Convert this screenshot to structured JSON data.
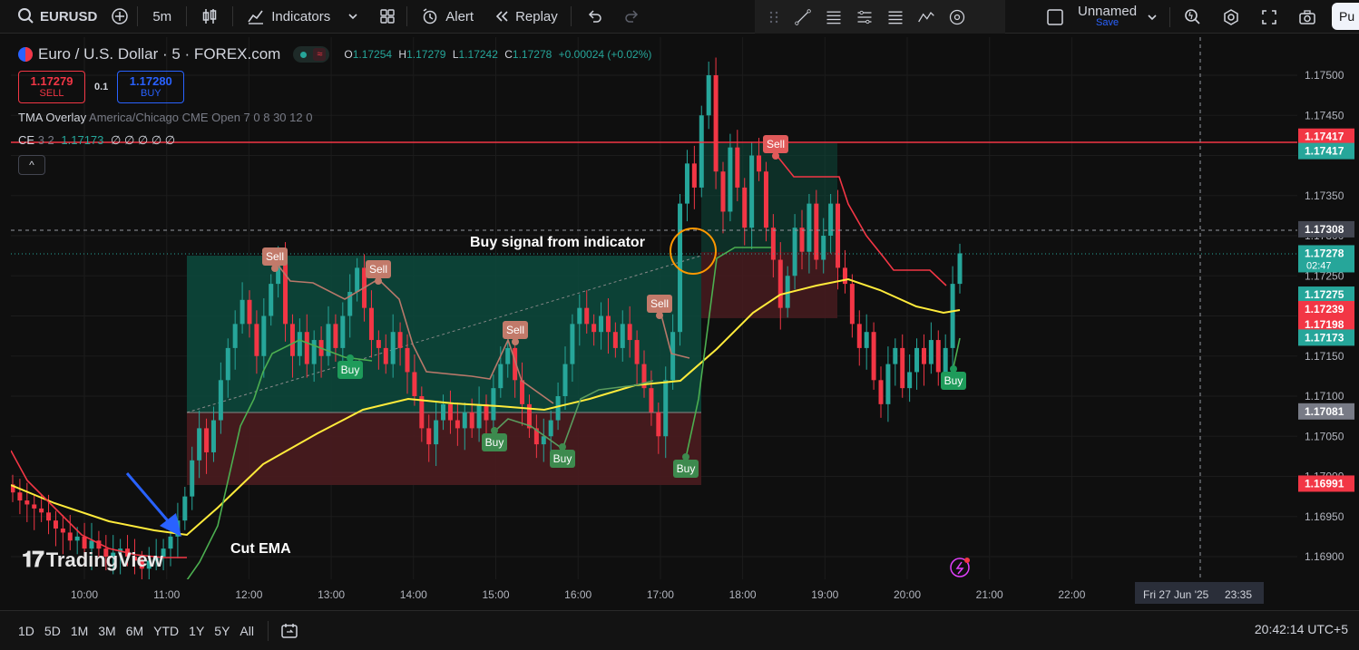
{
  "toolbar": {
    "symbol": "EURUSD",
    "interval": "5m",
    "indicators_label": "Indicators",
    "alert_label": "Alert",
    "replay_label": "Replay",
    "layout_name": "Unnamed",
    "layout_save": "Save",
    "publish_label": "Pu"
  },
  "legend": {
    "title": "Euro / U.S. Dollar · 5 · FOREX.com",
    "open_label": "O",
    "open": "1.17254",
    "high_label": "H",
    "high": "1.17279",
    "low_label": "L",
    "low": "1.17242",
    "close_label": "C",
    "close": "1.17278",
    "change": "+0.00024 (+0.02%)",
    "sell_price": "1.17279",
    "sell_label": "SELL",
    "buy_price": "1.17280",
    "buy_label": "BUY",
    "quantity": "0.1",
    "ind1_name": "TMA Overlay",
    "ind1_params": "America/Chicago CME Open 7 0 8 30 12 0",
    "ind2_name": "CE",
    "ind2_params": "3 2",
    "ind2_value": "1.17173",
    "ind2_extra": "∅ ∅ ∅ ∅ ∅",
    "collapse_glyph": "^"
  },
  "annotations": {
    "buy_signal": "Buy signal from indicator",
    "cut_ema": "Cut EMA"
  },
  "logo_text": "TradingView",
  "bottom": {
    "ranges": [
      "1D",
      "5D",
      "1M",
      "3M",
      "6M",
      "YTD",
      "1Y",
      "5Y",
      "All"
    ],
    "clock": "20:42:14 UTC+5"
  },
  "crosshair_date": "Fri 27 Jun '25",
  "crosshair_time": "23:35",
  "colors": {
    "up": "#26a69a",
    "down": "#f23645",
    "ema": "#ffeb3b",
    "upper_band": "#f23645",
    "lower_band": "#4caf50",
    "sell_tag": "#c27a6a",
    "buy_tag": "#3d8a4e"
  },
  "chart_data": {
    "type": "candlestick",
    "yticks": [
      "1.16900",
      "1.16950",
      "1.17000",
      "1.17050",
      "1.17100",
      "1.17150",
      "1.17200",
      "1.17250",
      "1.17300",
      "1.17350",
      "1.17400",
      "1.17450",
      "1.17500"
    ],
    "xticks": [
      "10:00",
      "11:00",
      "12:00",
      "13:00",
      "14:00",
      "15:00",
      "16:00",
      "17:00",
      "18:00",
      "19:00",
      "20:00",
      "21:00",
      "22:00"
    ],
    "price_tags": [
      {
        "label": "1.17417",
        "value": 1.17417,
        "color": "#f23645",
        "y": 1.174235
      },
      {
        "label": "1.17417",
        "value": 1.17417,
        "color": "#26a69a",
        "y": 1.174055
      },
      {
        "label": "1.17308",
        "value": 1.17308,
        "color": "#434651",
        "y": 1.17308
      },
      {
        "label": "1.17278",
        "value": 1.17278,
        "color": "#26a69a",
        "y": 1.17278,
        "sub": "02:47"
      },
      {
        "label": "1.17275",
        "value": 1.17275,
        "color": "#26a69a",
        "y": 1.172265
      },
      {
        "label": "1.17239",
        "value": 1.17239,
        "color": "#f23645",
        "y": 1.172085
      },
      {
        "label": "1.17198",
        "value": 1.17198,
        "color": "#f23645",
        "y": 1.171895
      },
      {
        "label": "1.17173",
        "value": 1.17173,
        "color": "#26a69a",
        "y": 1.17173
      },
      {
        "label": "1.17081",
        "value": 1.17081,
        "color": "#787b86",
        "y": 1.17081
      },
      {
        "label": "1.16991",
        "value": 1.16991,
        "color": "#f23645",
        "y": 1.16991
      }
    ],
    "signals": [
      {
        "type": "Sell",
        "x": 303,
        "y": 283
      },
      {
        "type": "Sell",
        "x": 417,
        "y": 297
      },
      {
        "type": "Sell",
        "x": 568,
        "y": 364
      },
      {
        "type": "Sell",
        "x": 727,
        "y": 335
      },
      {
        "type": "Sell",
        "x": 855,
        "y": 159
      },
      {
        "type": "Buy",
        "x": 386,
        "y": 408
      },
      {
        "type": "Buy",
        "x": 545,
        "y": 488
      },
      {
        "type": "Buy",
        "x": 620,
        "y": 506
      },
      {
        "type": "Buy",
        "x": 756,
        "y": 517
      },
      {
        "type": "Buy",
        "x": 1051,
        "y": 420
      }
    ]
  }
}
